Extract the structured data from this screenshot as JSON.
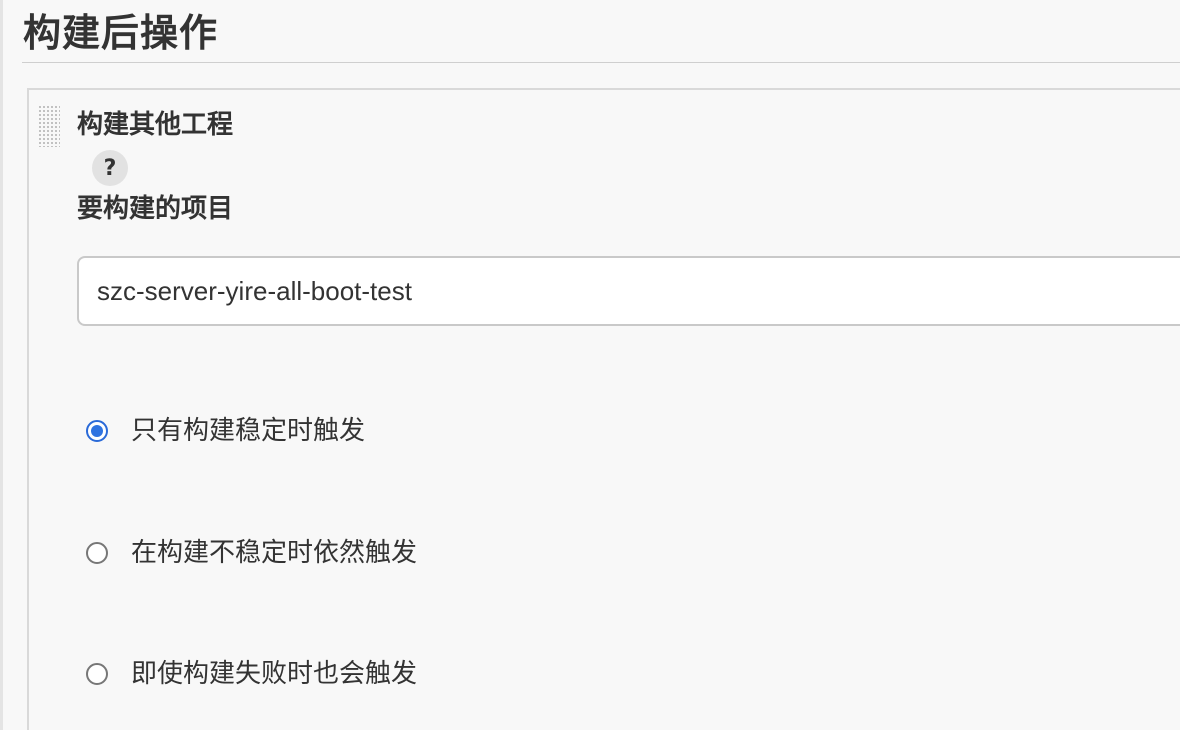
{
  "section": {
    "title": "构建后操作"
  },
  "step": {
    "title": "构建其他工程",
    "help_icon": "?",
    "field_label": "要构建的项目",
    "projects_value": "szc-server-yire-all-boot-test"
  },
  "trigger_options": [
    {
      "label": "只有构建稳定时触发",
      "checked": true
    },
    {
      "label": "在构建不稳定时依然触发",
      "checked": false
    },
    {
      "label": "即使构建失败时也会触发",
      "checked": false
    }
  ],
  "colors": {
    "radio_accent": "#2f73e0",
    "panel_bg": "#f8f8f8",
    "text": "#333333"
  }
}
